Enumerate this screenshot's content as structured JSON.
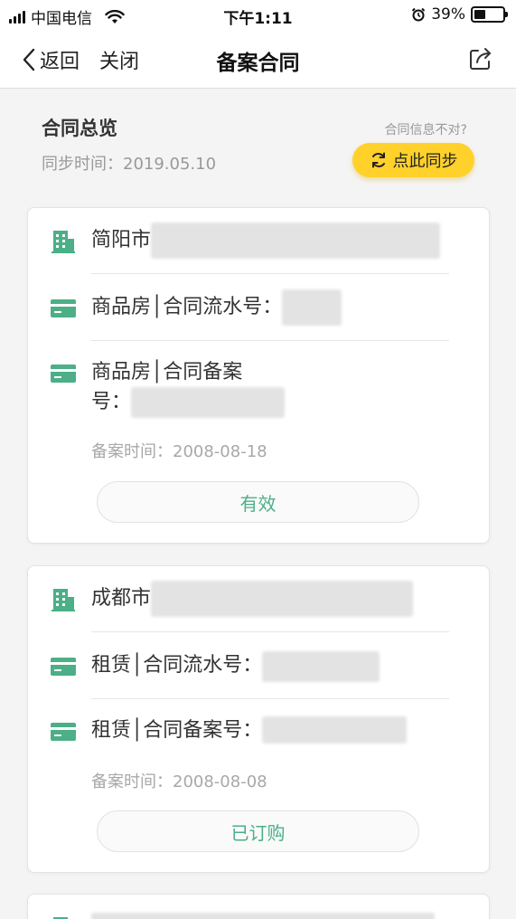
{
  "status_bar": {
    "carrier": "中国电信",
    "time": "下午1:11",
    "battery_percent": "39%",
    "battery_level": 0.39
  },
  "nav": {
    "back_label": "返回",
    "close_label": "关闭",
    "title": "备案合同"
  },
  "overview": {
    "title": "合同总览",
    "sync_time": "同步时间：2019.05.10",
    "hint": "合同信息不对?",
    "sync_button_label": "点此同步"
  },
  "contracts": [
    {
      "address": "简阳市",
      "serial_label": "商品房│合同流水号：",
      "filing_label_1": "商品房│合同备案",
      "filing_label_2": "号：",
      "filed_time": "备案时间：2008-08-18",
      "status": "有效"
    },
    {
      "address": "成都市",
      "serial_label": "租赁│合同流水号：",
      "filing_label": "租赁│合同备案号：",
      "filed_time": "备案时间：2008-08-08",
      "status": "已订购"
    }
  ],
  "accent_color": "#4caf87",
  "sync_button_color": "#ffd12a",
  "icons": {
    "building": "building-icon",
    "contract": "contract-card-icon",
    "sync": "sync-icon",
    "share": "share-icon",
    "back": "chevron-left-icon"
  }
}
